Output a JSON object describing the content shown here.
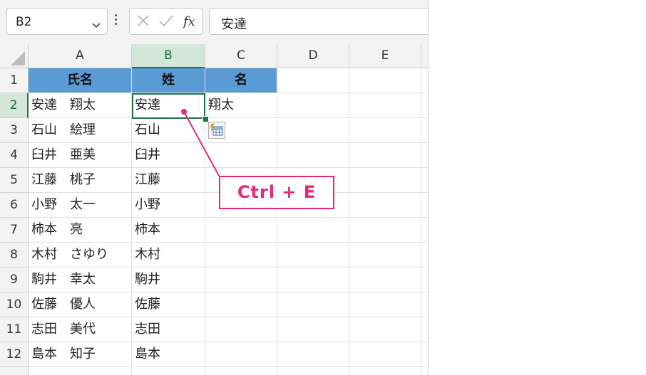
{
  "name_box": {
    "value": "B2"
  },
  "formula_bar": {
    "value": "安達"
  },
  "columns": [
    "A",
    "B",
    "C",
    "D",
    "E"
  ],
  "selected_column": "B",
  "rows": [
    "1",
    "2",
    "3",
    "4",
    "5",
    "6",
    "7",
    "8",
    "9",
    "10",
    "11",
    "12"
  ],
  "selected_row": "2",
  "header_row": {
    "a": "氏名",
    "b": "姓",
    "c": "名"
  },
  "data_rows": [
    {
      "a": "安達　翔太",
      "b": "安達",
      "c": "翔太"
    },
    {
      "a": "石山　絵理",
      "b": "石山",
      "c": ""
    },
    {
      "a": "臼井　亜美",
      "b": "臼井",
      "c": ""
    },
    {
      "a": "江藤　桃子",
      "b": "江藤",
      "c": ""
    },
    {
      "a": "小野　太一",
      "b": "小野",
      "c": ""
    },
    {
      "a": "柿本　亮",
      "b": "柿本",
      "c": ""
    },
    {
      "a": "木村　さゆり",
      "b": "木村",
      "c": ""
    },
    {
      "a": "駒井　幸太",
      "b": "駒井",
      "c": ""
    },
    {
      "a": "佐藤　優人",
      "b": "佐藤",
      "c": ""
    },
    {
      "a": "志田　美代",
      "b": "志田",
      "c": ""
    },
    {
      "a": "島本　知子",
      "b": "島本",
      "c": ""
    }
  ],
  "callout": {
    "text": "Ctrl + E"
  },
  "colors": {
    "header_fill": "#5b9bd5",
    "selection": "#217346",
    "callout": "#e6287a"
  },
  "icons": [
    "chevron-down-icon",
    "more-vertical-icon",
    "cancel-x-icon",
    "check-icon",
    "fx-icon",
    "flash-fill-icon"
  ]
}
